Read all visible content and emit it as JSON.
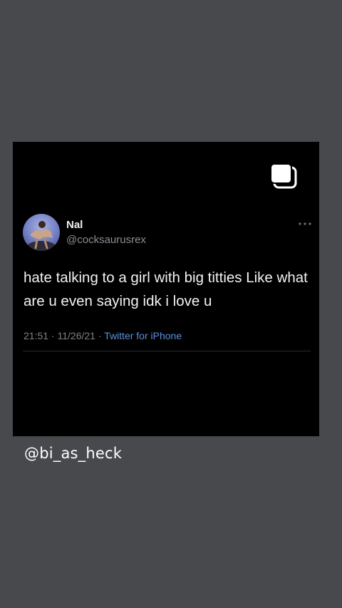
{
  "tweet": {
    "name": "Nal",
    "handle": "@cocksaurusrex",
    "text": "hate talking to a girl with big titties Like what are u even saying idk i love u",
    "time": "21:51",
    "date": "11/26/21",
    "separator": " · ",
    "client": "Twitter for iPhone"
  },
  "caption": "@bi_as_heck",
  "icons": {
    "multi_post": "multiple-posts-icon",
    "more": "more-options-icon",
    "avatar": "avatar"
  },
  "colors": {
    "background": "#48494d",
    "post_background": "#000000",
    "link": "#5b8fd9"
  }
}
